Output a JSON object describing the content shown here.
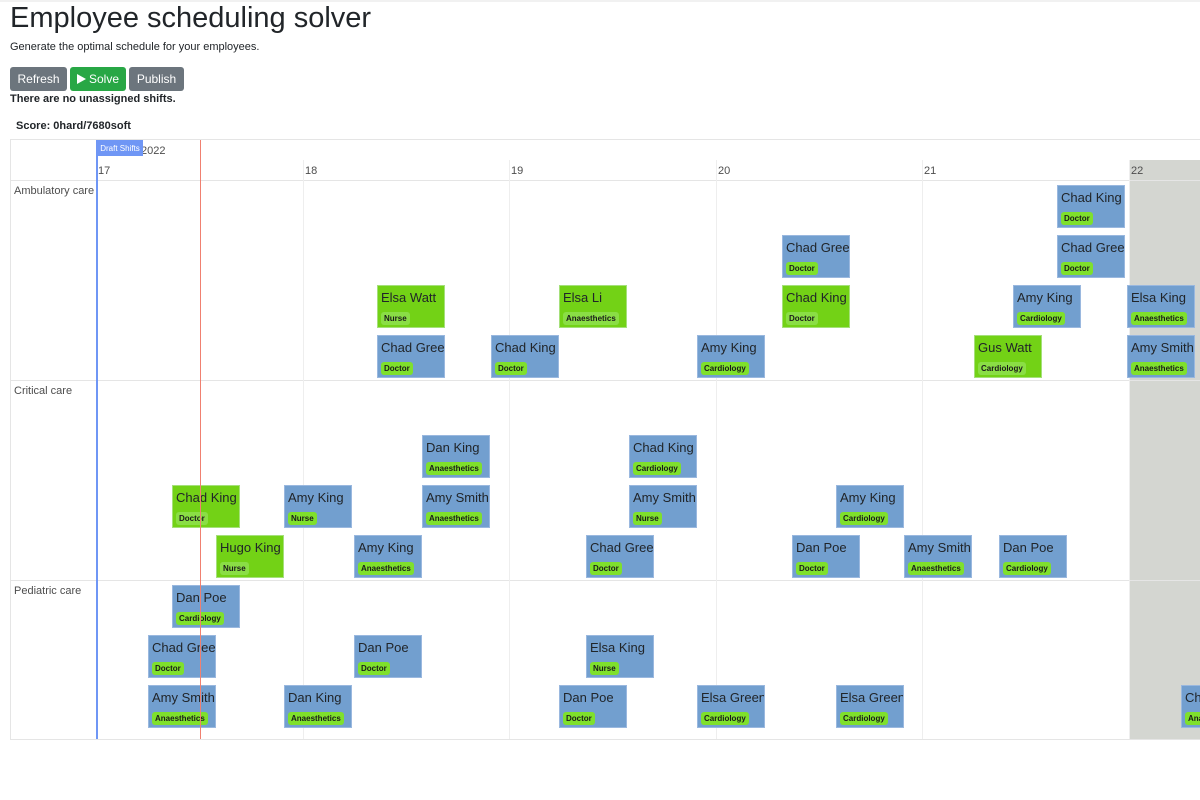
{
  "page": {
    "title": "Employee scheduling solver",
    "subtitle": "Generate the optimal schedule for your employees."
  },
  "toolbar": {
    "refresh_label": "Refresh",
    "solve_label": "Solve",
    "publish_label": "Publish"
  },
  "status": {
    "unassigned": "There are no unassigned shifts.",
    "score": "Score: 0hard/7680soft"
  },
  "colors": {
    "published": "#729fcf",
    "draft": "#73d216",
    "badge": "#7fe02c",
    "now_line": "#f08070",
    "draft_marker": "#6f96f5",
    "weekend": "#d4d6d1"
  },
  "timeline": {
    "year_label": "2022",
    "draft_label": "Draft Shifts",
    "days": [
      "17",
      "18",
      "19",
      "20",
      "21",
      "22"
    ],
    "groups": [
      {
        "label": "Ambulatory care"
      },
      {
        "label": "Critical care"
      },
      {
        "label": "Pediatric care"
      }
    ]
  },
  "shifts": [
    {
      "group": 0,
      "lane": 0,
      "day": 4.65,
      "name": "Chad King",
      "skill": "Doctor",
      "state": "published"
    },
    {
      "group": 0,
      "lane": 1,
      "day": 3.32,
      "name": "Chad Green",
      "skill": "Doctor",
      "state": "published"
    },
    {
      "group": 0,
      "lane": 1,
      "day": 4.65,
      "name": "Chad Green",
      "skill": "Doctor",
      "state": "published"
    },
    {
      "group": 0,
      "lane": 2,
      "day": 1.36,
      "name": "Elsa Watt",
      "skill": "Nurse",
      "state": "draft"
    },
    {
      "group": 0,
      "lane": 2,
      "day": 2.24,
      "name": "Elsa Li",
      "skill": "Anaesthetics",
      "state": "draft"
    },
    {
      "group": 0,
      "lane": 2,
      "day": 3.32,
      "name": "Chad King",
      "skill": "Doctor",
      "state": "draft"
    },
    {
      "group": 0,
      "lane": 2,
      "day": 4.44,
      "name": "Amy King",
      "skill": "Cardiology",
      "state": "published"
    },
    {
      "group": 0,
      "lane": 2,
      "day": 4.99,
      "name": "Elsa King",
      "skill": "Anaesthetics",
      "state": "published"
    },
    {
      "group": 0,
      "lane": 3,
      "day": 1.36,
      "name": "Chad Green",
      "skill": "Doctor",
      "state": "published"
    },
    {
      "group": 0,
      "lane": 3,
      "day": 1.91,
      "name": "Chad King",
      "skill": "Doctor",
      "state": "published"
    },
    {
      "group": 0,
      "lane": 3,
      "day": 2.91,
      "name": "Amy King",
      "skill": "Cardiology",
      "state": "published"
    },
    {
      "group": 0,
      "lane": 3,
      "day": 4.25,
      "name": "Gus Watt",
      "skill": "Cardiology",
      "state": "draft"
    },
    {
      "group": 0,
      "lane": 3,
      "day": 4.99,
      "name": "Amy Smith",
      "skill": "Anaesthetics",
      "state": "published"
    },
    {
      "group": 1,
      "lane": 1,
      "day": 1.58,
      "name": "Dan King",
      "skill": "Anaesthetics",
      "state": "published"
    },
    {
      "group": 1,
      "lane": 1,
      "day": 2.58,
      "name": "Chad King",
      "skill": "Cardiology",
      "state": "published"
    },
    {
      "group": 1,
      "lane": 2,
      "day": 0.37,
      "name": "Chad King",
      "skill": "Doctor",
      "state": "draft"
    },
    {
      "group": 1,
      "lane": 2,
      "day": 0.91,
      "name": "Amy King",
      "skill": "Nurse",
      "state": "published"
    },
    {
      "group": 1,
      "lane": 2,
      "day": 1.58,
      "name": "Amy Smith",
      "skill": "Anaesthetics",
      "state": "published"
    },
    {
      "group": 1,
      "lane": 2,
      "day": 2.58,
      "name": "Amy Smith",
      "skill": "Nurse",
      "state": "published"
    },
    {
      "group": 1,
      "lane": 2,
      "day": 3.58,
      "name": "Amy King",
      "skill": "Cardiology",
      "state": "published"
    },
    {
      "group": 1,
      "lane": 3,
      "day": 0.58,
      "name": "Hugo King",
      "skill": "Nurse",
      "state": "draft"
    },
    {
      "group": 1,
      "lane": 3,
      "day": 1.25,
      "name": "Amy King",
      "skill": "Anaesthetics",
      "state": "published"
    },
    {
      "group": 1,
      "lane": 3,
      "day": 2.37,
      "name": "Chad Green",
      "skill": "Doctor",
      "state": "published"
    },
    {
      "group": 1,
      "lane": 3,
      "day": 3.37,
      "name": "Dan Poe",
      "skill": "Doctor",
      "state": "published"
    },
    {
      "group": 1,
      "lane": 3,
      "day": 3.91,
      "name": "Amy Smith",
      "skill": "Anaesthetics",
      "state": "published"
    },
    {
      "group": 1,
      "lane": 3,
      "day": 4.37,
      "name": "Dan Poe",
      "skill": "Cardiology",
      "state": "published"
    },
    {
      "group": 2,
      "lane": 0,
      "day": 0.37,
      "name": "Dan Poe",
      "skill": "Cardiology",
      "state": "published"
    },
    {
      "group": 2,
      "lane": 1,
      "day": 0.25,
      "name": "Chad Green",
      "skill": "Doctor",
      "state": "published"
    },
    {
      "group": 2,
      "lane": 1,
      "day": 1.25,
      "name": "Dan Poe",
      "skill": "Doctor",
      "state": "published"
    },
    {
      "group": 2,
      "lane": 1,
      "day": 2.37,
      "name": "Elsa King",
      "skill": "Nurse",
      "state": "published"
    },
    {
      "group": 2,
      "lane": 2,
      "day": 0.25,
      "name": "Amy Smith",
      "skill": "Anaesthetics",
      "state": "published"
    },
    {
      "group": 2,
      "lane": 2,
      "day": 0.91,
      "name": "Dan King",
      "skill": "Anaesthetics",
      "state": "published"
    },
    {
      "group": 2,
      "lane": 2,
      "day": 2.24,
      "name": "Dan Poe",
      "skill": "Doctor",
      "state": "published"
    },
    {
      "group": 2,
      "lane": 2,
      "day": 2.91,
      "name": "Elsa Green",
      "skill": "Cardiology",
      "state": "published"
    },
    {
      "group": 2,
      "lane": 2,
      "day": 3.58,
      "name": "Elsa Green",
      "skill": "Cardiology",
      "state": "published"
    },
    {
      "group": 2,
      "lane": 2,
      "day": 5.25,
      "name": "Chad King",
      "skill": "Anaesthetics",
      "state": "published"
    }
  ]
}
